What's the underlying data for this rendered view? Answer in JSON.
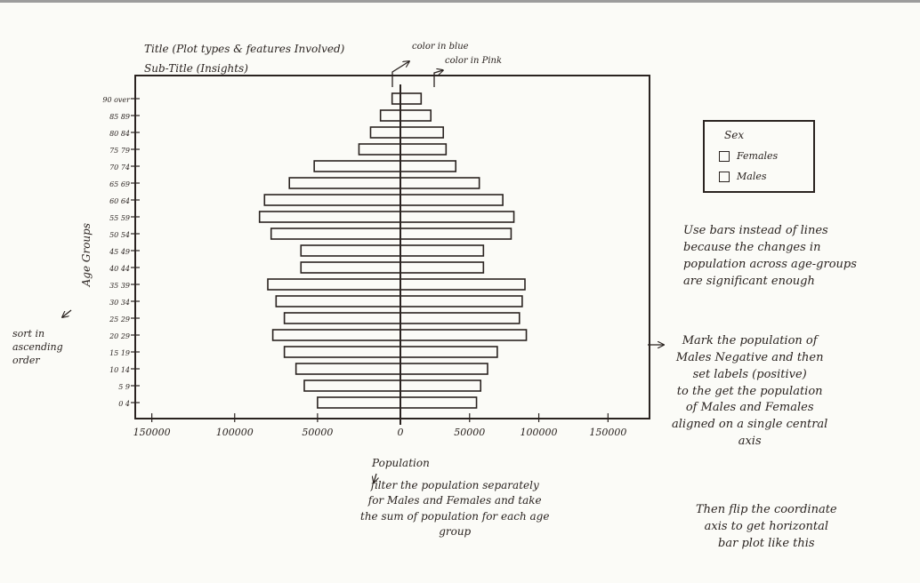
{
  "sketch": {
    "title": "Title (Plot types & features Involved)",
    "subtitle": "Sub-Title (Insights)",
    "annotations": {
      "blue": "color in blue",
      "pink": "color in Pink"
    },
    "legend": {
      "title": "Sex",
      "items": [
        "Females",
        "Males"
      ]
    },
    "notes": {
      "bars": "Use bars instead of lines\nbecause the changes in\npopulation across age-groups\nare significant enough",
      "mark": "Mark the population of\nMales Negative and then\nset labels (positive)\nto the get the population\nof Males and Females\naligned on a single central\naxis",
      "flip": "Then flip the coordinate\naxis to get horizontal\nbar plot like this",
      "filter": "filter the population separately\nfor Males and Females and take\nthe sum of population for each age\ngroup",
      "sort": "sort in\nascending\norder",
      "axis_y": "Age Groups",
      "axis_x": "Population"
    }
  },
  "chart_data": {
    "type": "bar",
    "orientation": "horizontal",
    "categories": [
      "90 over",
      "85 89",
      "80 84",
      "75 79",
      "70 74",
      "65 69",
      "60 64",
      "55 59",
      "50 54",
      "45 49",
      "40 44",
      "35 39",
      "30 34",
      "25 29",
      "20 29",
      "15 19",
      "10 14",
      "5 9",
      "0 4"
    ],
    "series": [
      {
        "name": "Males",
        "values": [
          -5000,
          -12000,
          -18000,
          -25000,
          -52000,
          -67000,
          -82000,
          -85000,
          -78000,
          -60000,
          -60000,
          -80000,
          -75000,
          -70000,
          -77000,
          -70000,
          -63000,
          -58000,
          -50000
        ]
      },
      {
        "name": "Females",
        "values": [
          15000,
          22000,
          31000,
          33000,
          40000,
          57000,
          74000,
          82000,
          80000,
          60000,
          60000,
          90000,
          88000,
          86000,
          91000,
          70000,
          63000,
          58000,
          55000
        ]
      }
    ],
    "x_tick_labels": [
      "150000",
      "100000",
      "50000",
      "0",
      "50000",
      "100000",
      "150000"
    ],
    "x_ticks": [
      -150000,
      -100000,
      -50000,
      0,
      50000,
      100000,
      150000
    ],
    "xlim": [
      -160000,
      180000
    ],
    "xlabel": "Population",
    "ylabel": "Age Groups",
    "annotation_colors": {
      "blue": "#2f5fd0",
      "pink": "#e26aa8"
    },
    "ink_color": "#2a2320",
    "grid": false,
    "legend_position": "right"
  }
}
